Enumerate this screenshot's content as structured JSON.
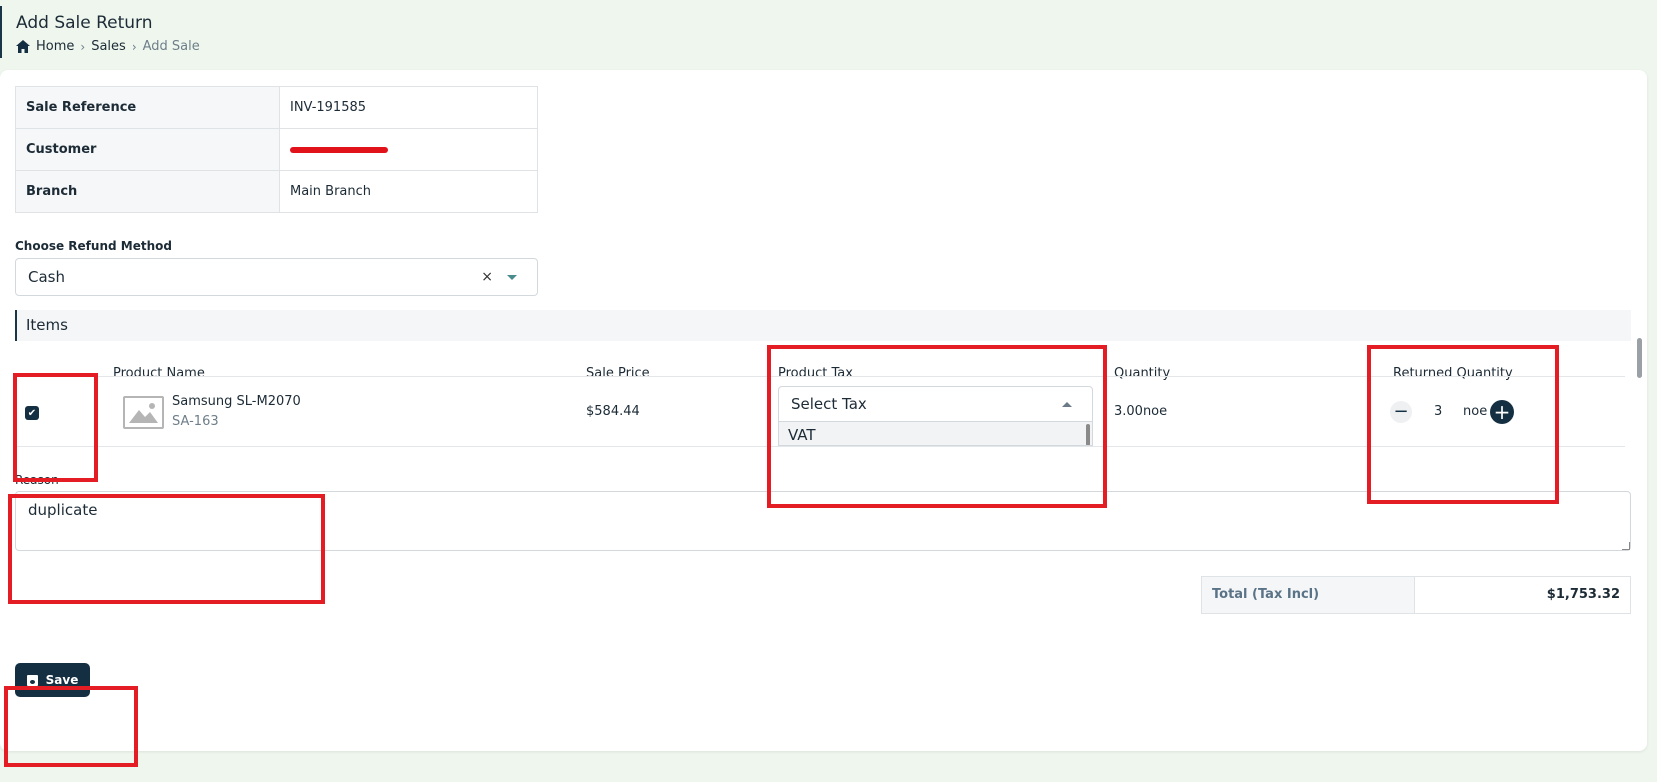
{
  "header": {
    "title": "Add Sale Return",
    "breadcrumb": {
      "home": "Home",
      "sales": "Sales",
      "current": "Add Sale"
    }
  },
  "info": {
    "rows": [
      {
        "label": "Sale Reference",
        "value": "INV-191585"
      },
      {
        "label": "Customer",
        "value": ""
      },
      {
        "label": "Branch",
        "value": "Main Branch"
      }
    ]
  },
  "refund": {
    "label": "Choose Refund Method",
    "value": "Cash",
    "clear": "×"
  },
  "items": {
    "title": "Items",
    "columns": {
      "product_name": "Product Name",
      "sale_price": "Sale Price",
      "product_tax": "Product Tax",
      "quantity": "Quantity",
      "returned_quantity": "Returned Quantity"
    },
    "rows": [
      {
        "checked": true,
        "name": "Samsung SL-M2070",
        "sku": "SA-163",
        "sale_price": "$584.44",
        "tax_placeholder": "Select Tax",
        "tax_options": [
          "VAT"
        ],
        "quantity": "3.00noe",
        "returned_qty": "3",
        "returned_unit": "noe"
      }
    ]
  },
  "reason": {
    "label": "Reason",
    "value": "duplicate"
  },
  "totals": {
    "label": "Total (Tax Incl)",
    "value": "$1,753.32"
  },
  "actions": {
    "save_label": "Save"
  },
  "colors": {
    "primary": "#152f42",
    "highlight": "#e41c23",
    "redaction": "#e2121a"
  }
}
